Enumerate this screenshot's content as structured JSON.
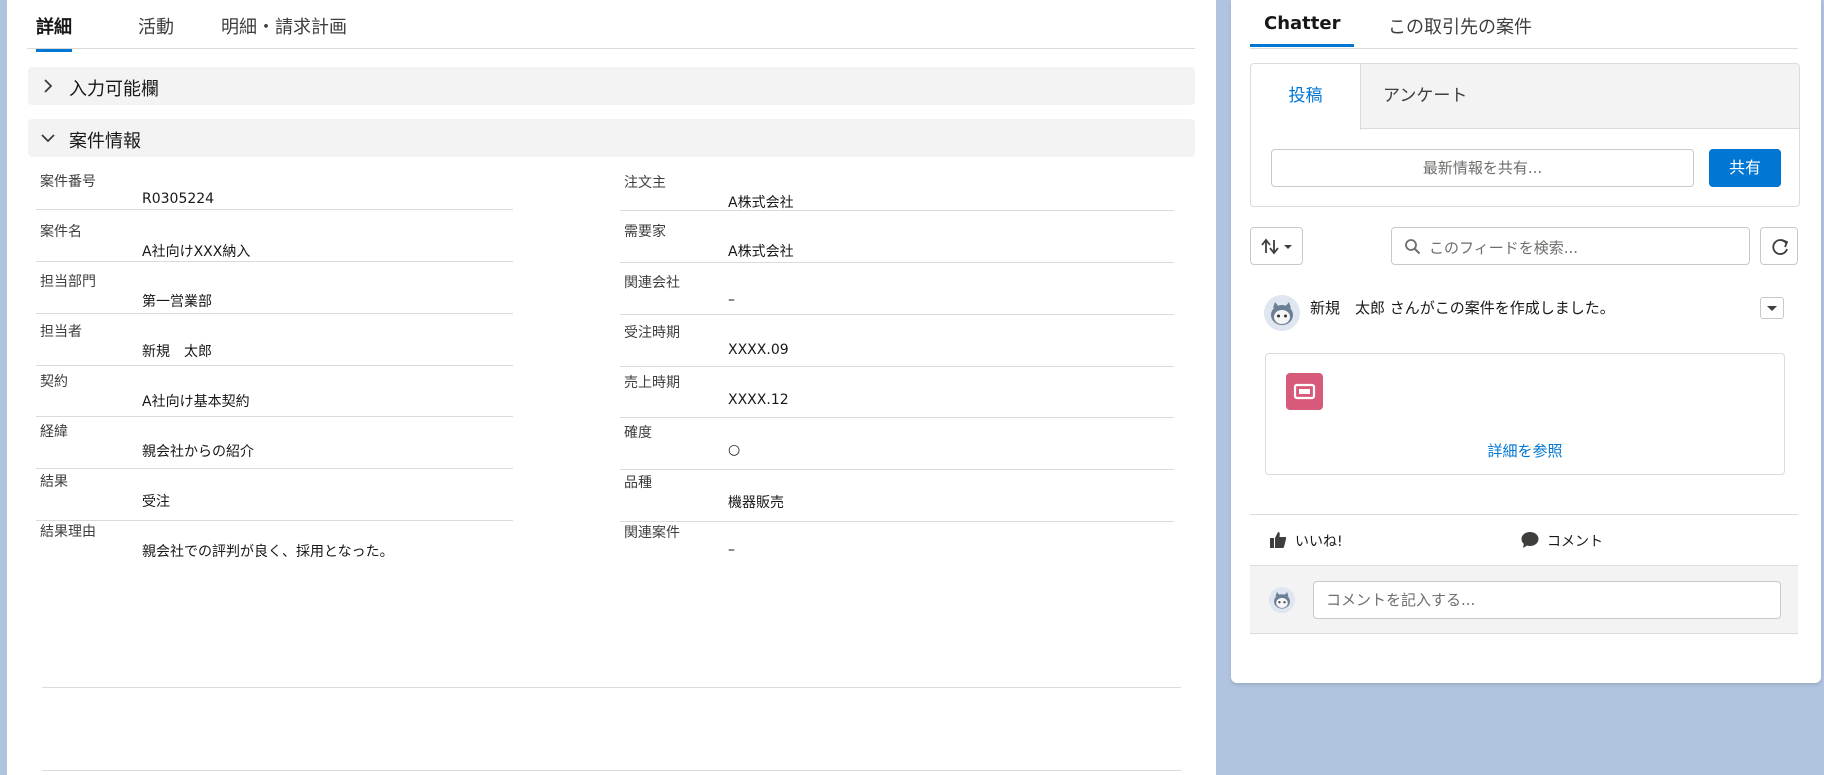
{
  "record_tabs": {
    "items": [
      "詳細",
      "活動",
      "明細・請求計画"
    ],
    "active_index": 0
  },
  "sections": {
    "input_section": {
      "title": "入力可能欄",
      "expanded": false
    },
    "deal_info": {
      "title": "案件情報",
      "expanded": true
    }
  },
  "fields": {
    "left": [
      {
        "label": "案件番号",
        "value": "R0305224"
      },
      {
        "label": "案件名",
        "value": "A社向けXXX納入"
      },
      {
        "label": "担当部門",
        "value": "第一営業部"
      },
      {
        "label": "担当者",
        "value": "新規　太郎"
      },
      {
        "label": "契約",
        "value": "A社向け基本契約"
      },
      {
        "label": "経緯",
        "value": "親会社からの紹介"
      },
      {
        "label": "結果",
        "value": "受注"
      },
      {
        "label": "結果理由",
        "value": "親会社での評判が良く、採用となった。"
      }
    ],
    "right": [
      {
        "label": "注文主",
        "value": "A株式会社"
      },
      {
        "label": "需要家",
        "value": "A株式会社"
      },
      {
        "label": "関連会社",
        "value": "–"
      },
      {
        "label": "受注時期",
        "value": "XXXX.09"
      },
      {
        "label": "売上時期",
        "value": "XXXX.12"
      },
      {
        "label": "確度",
        "value": "○"
      },
      {
        "label": "品種",
        "value": "機器販売"
      },
      {
        "label": "関連案件",
        "value": "–"
      }
    ]
  },
  "chatter": {
    "tabs": [
      "Chatter",
      "この取引先の案件"
    ],
    "active_index": 0,
    "publisher": {
      "tabs": [
        "投稿",
        "アンケート"
      ],
      "active_index": 0,
      "share_placeholder": "最新情報を共有...",
      "share_button": "共有"
    },
    "search_placeholder": "このフィードを検索...",
    "post": {
      "text": "新規　太郎 さんがこの案件を作成しました。",
      "detail_link": "詳細を参照",
      "like_label": "いいね!",
      "comment_label": "コメント",
      "comment_placeholder": "コメントを記入する..."
    }
  },
  "colors": {
    "accent": "#0176d3",
    "background": "#b0c4df",
    "record_icon": "#d75a7a"
  },
  "icons": [
    "chevron-right-icon",
    "chevron-down-icon",
    "sort-icon",
    "search-icon",
    "refresh-icon",
    "like-icon",
    "comment-icon",
    "record-icon",
    "avatar"
  ]
}
